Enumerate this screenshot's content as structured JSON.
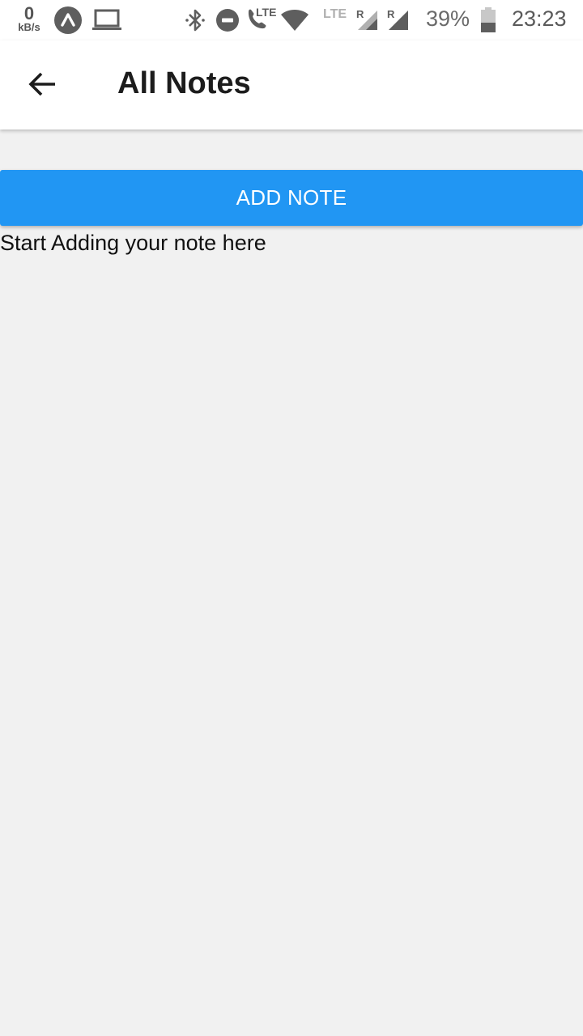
{
  "status_bar": {
    "net_speed_value": "0",
    "net_speed_unit": "kB/s",
    "lte_call_label": "LTE",
    "lte_sim1_label": "LTE",
    "roaming_label_1": "R",
    "roaming_label_2": "R",
    "battery_percent": "39%",
    "time": "23:23",
    "icons": [
      "netspeed",
      "app-notification-icon",
      "laptop-icon",
      "bluetooth-icon",
      "do-not-disturb-icon",
      "volte-call-icon",
      "wifi-icon",
      "signal-sim1-icon",
      "signal-sim2-icon",
      "battery-icon"
    ]
  },
  "app_bar": {
    "back_icon": "arrow-left-icon",
    "title": "All Notes"
  },
  "main": {
    "add_button_label": "ADD NOTE",
    "empty_hint": "Start Adding your note here"
  },
  "colors": {
    "accent": "#2196f3",
    "background": "#f1f1f1",
    "app_bar": "#ffffff"
  }
}
